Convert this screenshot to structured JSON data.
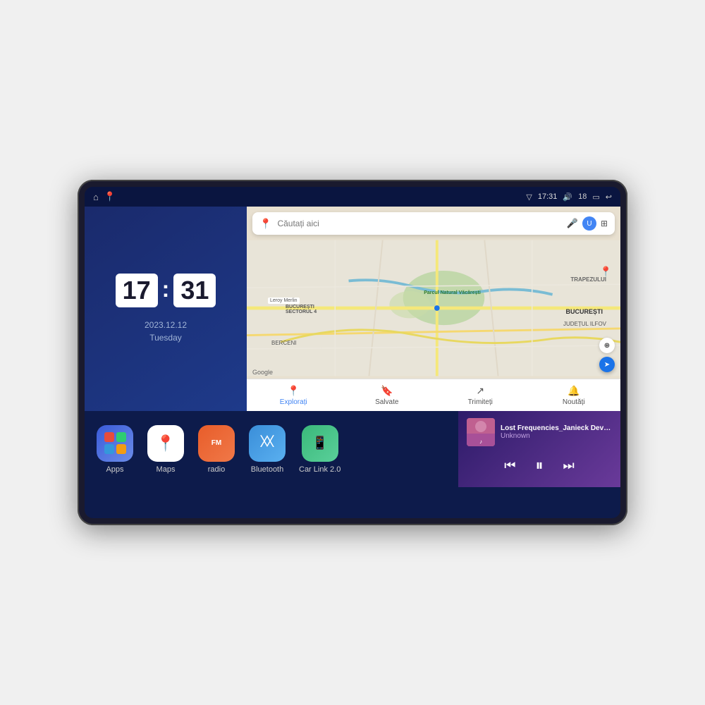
{
  "device": {
    "screen": {
      "status_bar": {
        "left_icons": [
          "home-icon",
          "maps-pin-icon"
        ],
        "signal_icon": "▽",
        "time": "17:31",
        "volume_icon": "🔊",
        "volume_level": "18",
        "battery_icon": "🔋",
        "back_icon": "↩"
      },
      "clock": {
        "hours": "17",
        "colon": ":",
        "minutes": "31",
        "date_line1": "2023.12.12",
        "date_line2": "Tuesday"
      },
      "map": {
        "search_placeholder": "Căutați aici",
        "nav_items": [
          {
            "label": "Explorați",
            "icon": "📍",
            "active": true
          },
          {
            "label": "Salvate",
            "icon": "🔖",
            "active": false
          },
          {
            "label": "Trimiteți",
            "icon": "🔄",
            "active": false
          },
          {
            "label": "Noutăți",
            "icon": "🔔",
            "active": false
          }
        ],
        "labels": {
          "trapezului": "TRAPEZULUI",
          "bucuresti": "BUCUREȘTI",
          "ilfov": "JUDEȚUL ILFOV",
          "berceni": "BERCENI",
          "leroy_merlin": "Leroy Merlin",
          "parcul": "Parcul Natural Văcărești",
          "sector4": "BUCUREȘTI\nSECTORUL 4",
          "google": "Google"
        }
      },
      "apps": [
        {
          "id": "apps",
          "label": "Apps",
          "type": "apps"
        },
        {
          "id": "maps",
          "label": "Maps",
          "type": "maps"
        },
        {
          "id": "radio",
          "label": "radio",
          "type": "radio"
        },
        {
          "id": "bluetooth",
          "label": "Bluetooth",
          "type": "bluetooth"
        },
        {
          "id": "carlink",
          "label": "Car Link 2.0",
          "type": "carlink"
        }
      ],
      "music": {
        "title": "Lost Frequencies_Janieck Devy-...",
        "artist": "Unknown",
        "controls": {
          "prev": "⏮",
          "play": "⏸",
          "next": "⏭"
        }
      }
    }
  }
}
